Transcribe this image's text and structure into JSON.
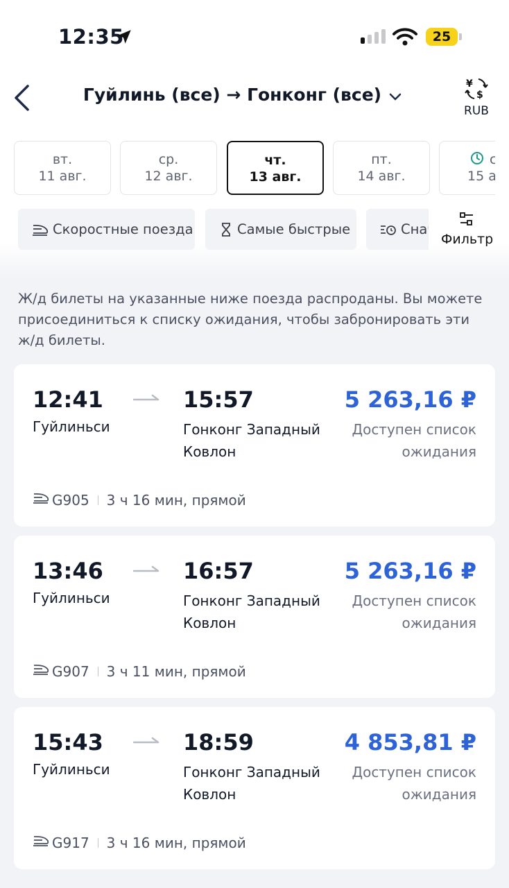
{
  "status_bar": {
    "time": "12:35",
    "battery": "25"
  },
  "header": {
    "title": "Гуйлинь (все) → Гонконг (все)",
    "currency": "RUB"
  },
  "date_tabs": [
    {
      "dow": "вт.",
      "day": "11 авг."
    },
    {
      "dow": "ср.",
      "day": "12 авг."
    },
    {
      "dow": "чт.",
      "day": "13 авг.",
      "selected": true
    },
    {
      "dow": "пт.",
      "day": "14 авг."
    },
    {
      "dow": "с",
      "day": "15 ав"
    }
  ],
  "chips": [
    {
      "label": "Скоростные поезда",
      "icon": "train-icon"
    },
    {
      "label": "Самые быстрые",
      "icon": "hourglass-icon"
    },
    {
      "label": "Снач",
      "icon": "clock-sort-icon"
    }
  ],
  "filter": {
    "label": "Фильтр",
    "icon": "filter-icon"
  },
  "notice": "Ж/д билеты на указанные ниже поезда распроданы. Вы можете присоединиться к списку ожидания, чтобы забронировать эти ж/д билеты.",
  "trains": [
    {
      "dep_time": "12:41",
      "dep_station": "Гуйлиньси",
      "arr_time": "15:57",
      "arr_station": "Гонконг Западный Ковлон",
      "price": "5 263,16 ₽",
      "status": "Доступен список ожидания",
      "number": "G905",
      "duration": "3 ч 16 мин, прямой"
    },
    {
      "dep_time": "13:46",
      "dep_station": "Гуйлиньси",
      "arr_time": "16:57",
      "arr_station": "Гонконг Западный Ковлон",
      "price": "5 263,16 ₽",
      "status": "Доступен список ожидания",
      "number": "G907",
      "duration": "3 ч 11 мин, прямой"
    },
    {
      "dep_time": "15:43",
      "dep_station": "Гуйлиньси",
      "arr_time": "18:59",
      "arr_station": "Гонконг Западный Ковлон",
      "price": "4 853,81 ₽",
      "status": "Доступен список ожидания",
      "number": "G917",
      "duration": "3 ч 16 мин, прямой"
    }
  ],
  "colors": {
    "price": "#2e63d8",
    "accent_clock": "#1a9a8a",
    "battery": "#f7d21a"
  }
}
